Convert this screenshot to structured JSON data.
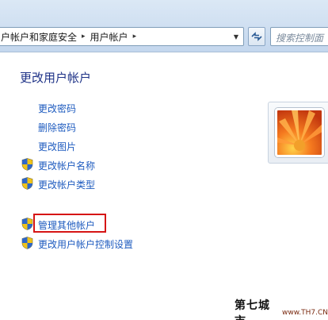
{
  "address_bar": {
    "crumbs": [
      "户帐户和家庭安全",
      "用户帐户"
    ]
  },
  "search": {
    "placeholder": "搜索控制面"
  },
  "main": {
    "title": "更改用户帐户",
    "links": [
      {
        "label": "更改密码",
        "shield": false
      },
      {
        "label": "删除密码",
        "shield": false
      },
      {
        "label": "更改图片",
        "shield": false
      },
      {
        "label": "更改帐户名称",
        "shield": true
      },
      {
        "label": "更改帐户类型",
        "shield": true
      }
    ],
    "other_links": [
      {
        "label": "管理其他帐户",
        "shield": true,
        "highlighted": true
      },
      {
        "label": "更改用户帐户控制设置",
        "shield": true
      }
    ]
  },
  "watermark": {
    "chinese": "第七城市",
    "site": "www.TH7.CN"
  },
  "colors": {
    "link": "#1e5bbf",
    "title": "#1e3287",
    "highlight": "#d61515"
  }
}
